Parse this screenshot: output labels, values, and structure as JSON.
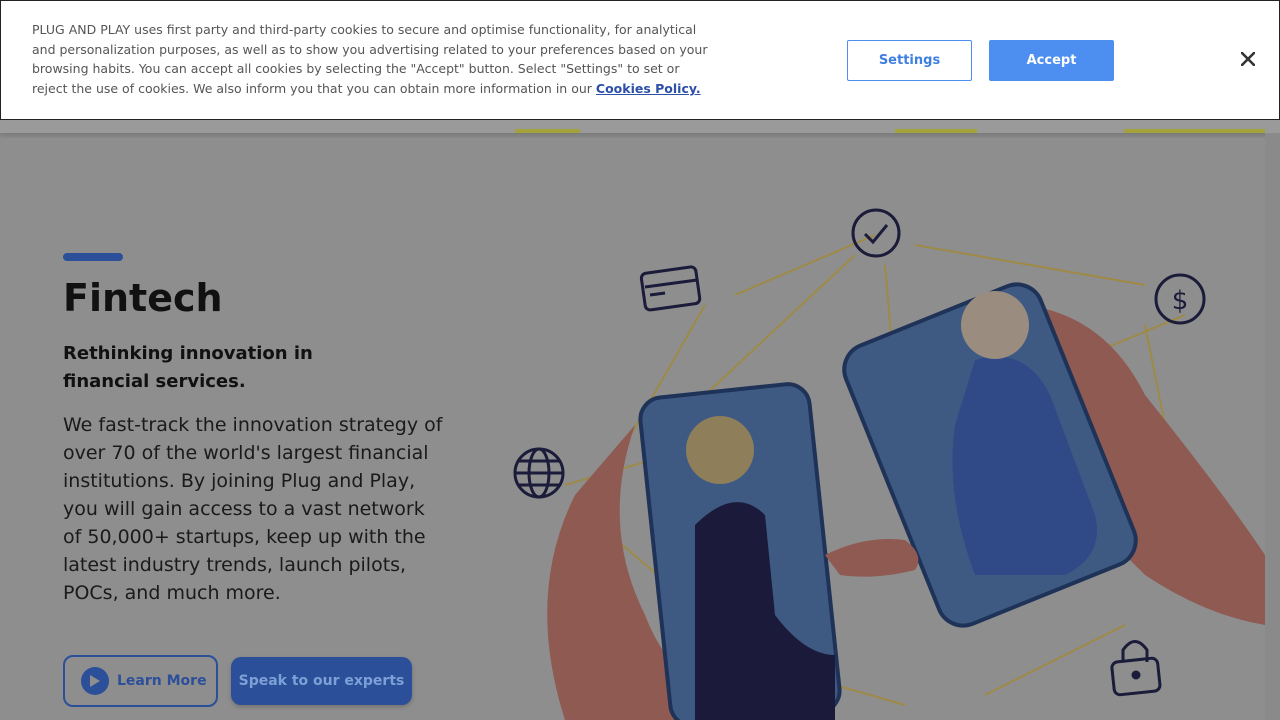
{
  "cookie_banner": {
    "text": "PLUG AND PLAY uses first party and third-party cookies to secure and optimise functionality, for analytical and personalization purposes, as well as to show you advertising related to your preferences based on your browsing habits. You can accept all cookies by selecting the \"Accept\" button. Select \"Settings\" to set or reject the use of cookies. We also inform you that you can obtain more information in our",
    "link_label": "Cookies Policy.",
    "settings_label": "Settings",
    "accept_label": "Accept",
    "close_icon": "close-icon"
  },
  "hero": {
    "title": "Fintech",
    "subtitle": "Rethinking innovation in financial services.",
    "description": "We fast-track the innovation strategy of over 70 of the world's largest financial institutions. By joining Plug and Play, you will gain access to a vast network of 50,000+ startups, keep up with the latest industry trends, launch pilots, POCs, and much more.",
    "learn_more_label": "Learn More",
    "speak_label": "Speak to our experts"
  },
  "icons": [
    "play-icon",
    "check-icon",
    "credit-card-icon",
    "dollar-icon",
    "globe-icon",
    "lock-icon"
  ],
  "colors": {
    "brand_blue": "#2c4f99",
    "accept_blue": "#4d8ff0",
    "nav_underline": "#c9c840",
    "overlay_gray": "#8d8d8d"
  }
}
